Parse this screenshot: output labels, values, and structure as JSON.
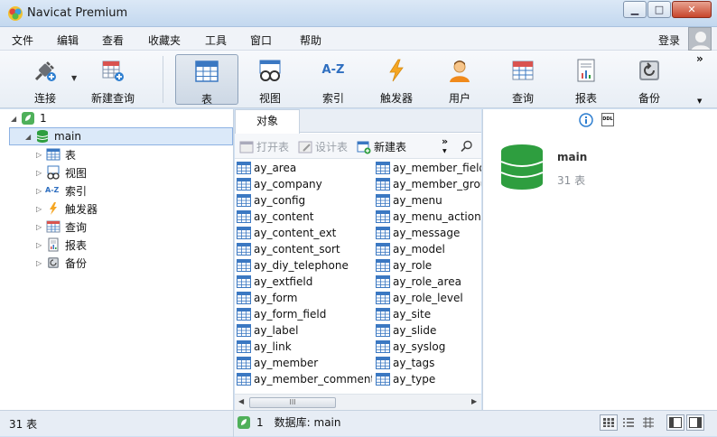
{
  "window": {
    "title": "Navicat Premium",
    "minimize": "▁",
    "maximize": "□",
    "close": "✕"
  },
  "menu": {
    "items": [
      "文件",
      "编辑",
      "查看",
      "收藏夹",
      "工具",
      "窗口",
      "帮助"
    ],
    "login": "登录"
  },
  "toolbar": {
    "connect": "连接",
    "new_query": "新建查询",
    "table": "表",
    "view": "视图",
    "index": "索引",
    "trigger": "触发器",
    "user": "用户",
    "query": "查询",
    "report": "报表",
    "backup": "备份",
    "index_glyph": "A-Z",
    "more": "»"
  },
  "tree": {
    "connection": "1",
    "database": "main",
    "nodes": [
      "表",
      "视图",
      "索引",
      "触发器",
      "查询",
      "报表",
      "备份"
    ]
  },
  "objects": {
    "tab": "对象",
    "open_table": "打开表",
    "design_table": "设计表",
    "new_table": "新建表",
    "more": "»",
    "col1": [
      "ay_area",
      "ay_company",
      "ay_config",
      "ay_content",
      "ay_content_ext",
      "ay_content_sort",
      "ay_diy_telephone",
      "ay_extfield",
      "ay_form",
      "ay_form_field",
      "ay_label",
      "ay_link",
      "ay_member",
      "ay_member_comment"
    ],
    "col2": [
      "ay_member_field",
      "ay_member_group",
      "ay_menu",
      "ay_menu_action",
      "ay_message",
      "ay_model",
      "ay_role",
      "ay_role_area",
      "ay_role_level",
      "ay_site",
      "ay_slide",
      "ay_syslog",
      "ay_tags",
      "ay_type"
    ],
    "scroll_grip": "III"
  },
  "info": {
    "db_name": "main",
    "count": "31 表",
    "ddl_label": "DDL"
  },
  "status": {
    "left": "31 表",
    "connection": "1",
    "database": "数据库: main"
  },
  "colors": {
    "accent": "#2e9e3f",
    "selection": "#dbe9f9",
    "table_icon": "#3b78c2"
  }
}
